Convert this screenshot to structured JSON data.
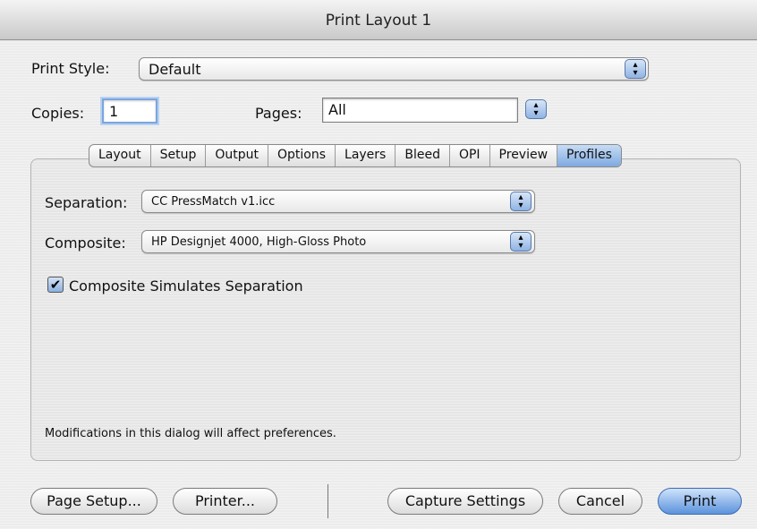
{
  "window": {
    "title": "Print Layout 1"
  },
  "print_style": {
    "label": "Print Style:",
    "value": "Default"
  },
  "copies": {
    "label": "Copies:",
    "value": "1"
  },
  "pages": {
    "label": "Pages:",
    "value": "All"
  },
  "tabs": [
    {
      "label": "Layout"
    },
    {
      "label": "Setup"
    },
    {
      "label": "Output"
    },
    {
      "label": "Options"
    },
    {
      "label": "Layers"
    },
    {
      "label": "Bleed"
    },
    {
      "label": "OPI"
    },
    {
      "label": "Preview"
    },
    {
      "label": "Profiles",
      "active": true
    }
  ],
  "profiles": {
    "separation": {
      "label": "Separation:",
      "value": "CC PressMatch v1.icc"
    },
    "composite": {
      "label": "Composite:",
      "value": "HP Designjet 4000, High-Gloss Photo"
    },
    "simulate": {
      "label": "Composite Simulates Separation",
      "checked": true
    },
    "note": "Modifications in this dialog will affect preferences."
  },
  "buttons": {
    "page_setup": "Page Setup...",
    "printer": "Printer...",
    "capture": "Capture Settings",
    "cancel": "Cancel",
    "print": "Print"
  },
  "glyphs": {
    "stepper": "▴▾",
    "check": "✔"
  },
  "colors": {
    "accent": "#7fa9e0"
  }
}
